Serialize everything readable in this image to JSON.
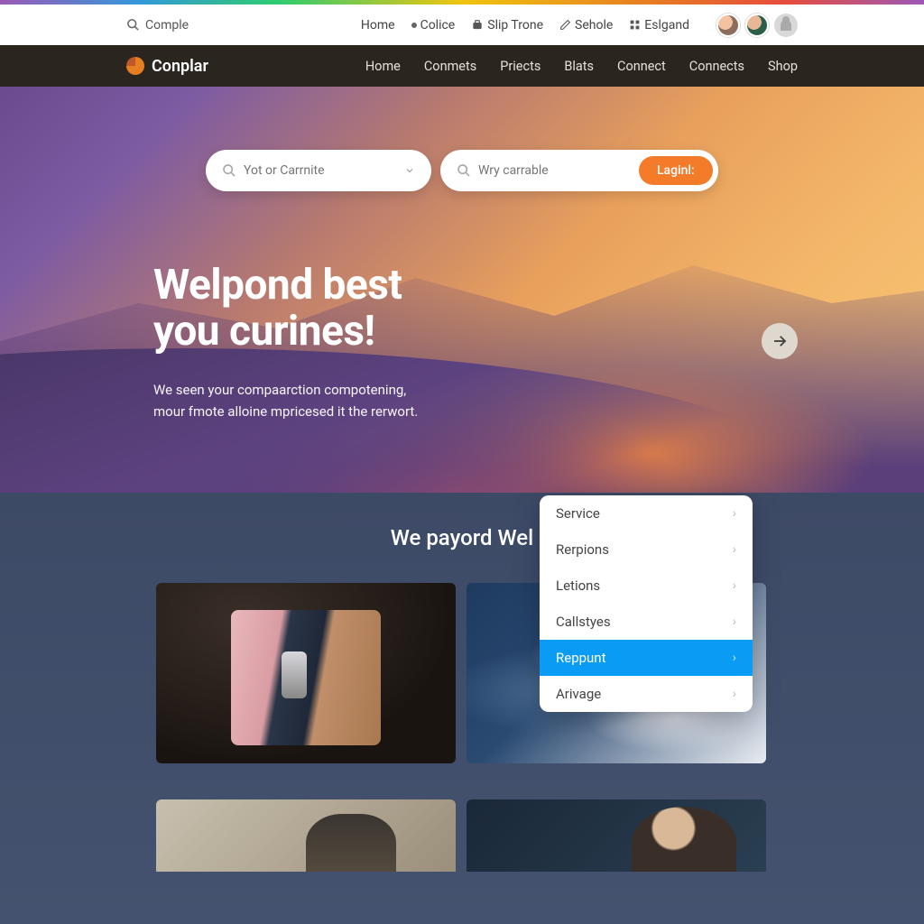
{
  "topbar": {
    "search_placeholder": "Comple",
    "nav": [
      {
        "label": "Home",
        "icon": null
      },
      {
        "label": "Colice",
        "icon": "dot"
      },
      {
        "label": "Slip Trone",
        "icon": "cart"
      },
      {
        "label": "Sehole",
        "icon": "pencil"
      },
      {
        "label": "Eslgand",
        "icon": "grid"
      }
    ]
  },
  "brand": {
    "name": "Conplar"
  },
  "mainnav": [
    "Home",
    "Conmets",
    "Priects",
    "Blats",
    "Connect",
    "Connects",
    "Shop"
  ],
  "hero": {
    "search1_placeholder": "Yot or Carrnite",
    "search2_placeholder": "Wry carrable",
    "login_label": "Laginl:",
    "title_line1": "Welpond best",
    "title_line2": "you curines!",
    "sub_line1": "We seen your compaarction compotening,",
    "sub_line2": "mour fmote alloine mpricesed it the rerwort."
  },
  "section": {
    "title": "We payord Wel"
  },
  "dropdown": {
    "items": [
      {
        "label": "Service",
        "active": false
      },
      {
        "label": "Rerpions",
        "active": false
      },
      {
        "label": "Letions",
        "active": false
      },
      {
        "label": "Callstyes",
        "active": false
      },
      {
        "label": "Reppunt",
        "active": true
      },
      {
        "label": "Arivage",
        "active": false
      }
    ]
  }
}
